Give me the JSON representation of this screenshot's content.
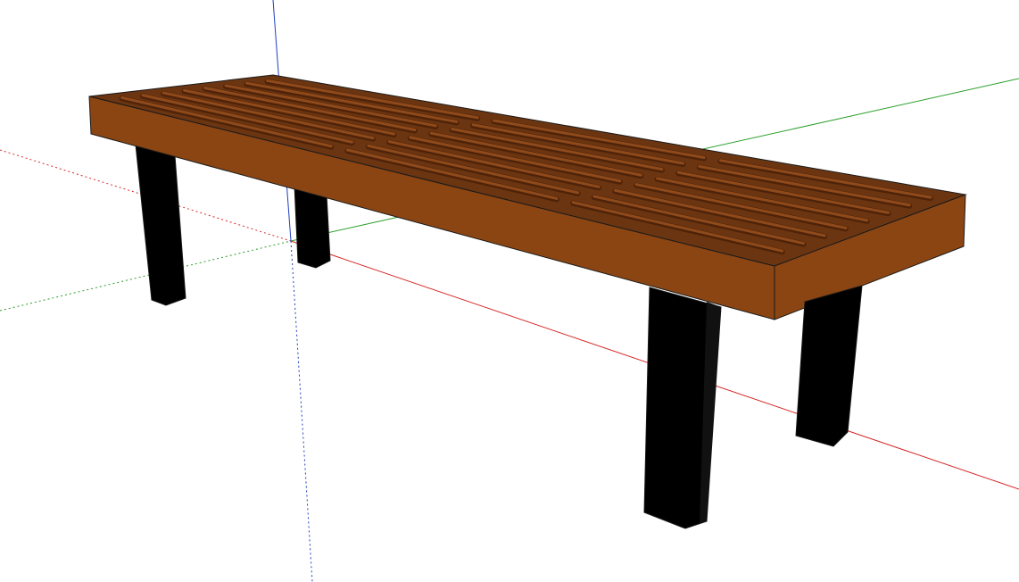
{
  "viewport": {
    "background": "#ffffff"
  },
  "axes": {
    "x_color": "#d62728",
    "y_color": "#2ca02c",
    "z_color": "#1f3fbf"
  },
  "model": {
    "name": "bench",
    "top_side_color": "#8b4513",
    "top_surface_color": "#6b3511",
    "slat_color": "#8f4a1b",
    "slat_groove_color": "#4f2309",
    "leg_color": "#000000",
    "outline_color": "#1a1a1a",
    "slat_rows_per_panel": 8,
    "panels": 3
  }
}
